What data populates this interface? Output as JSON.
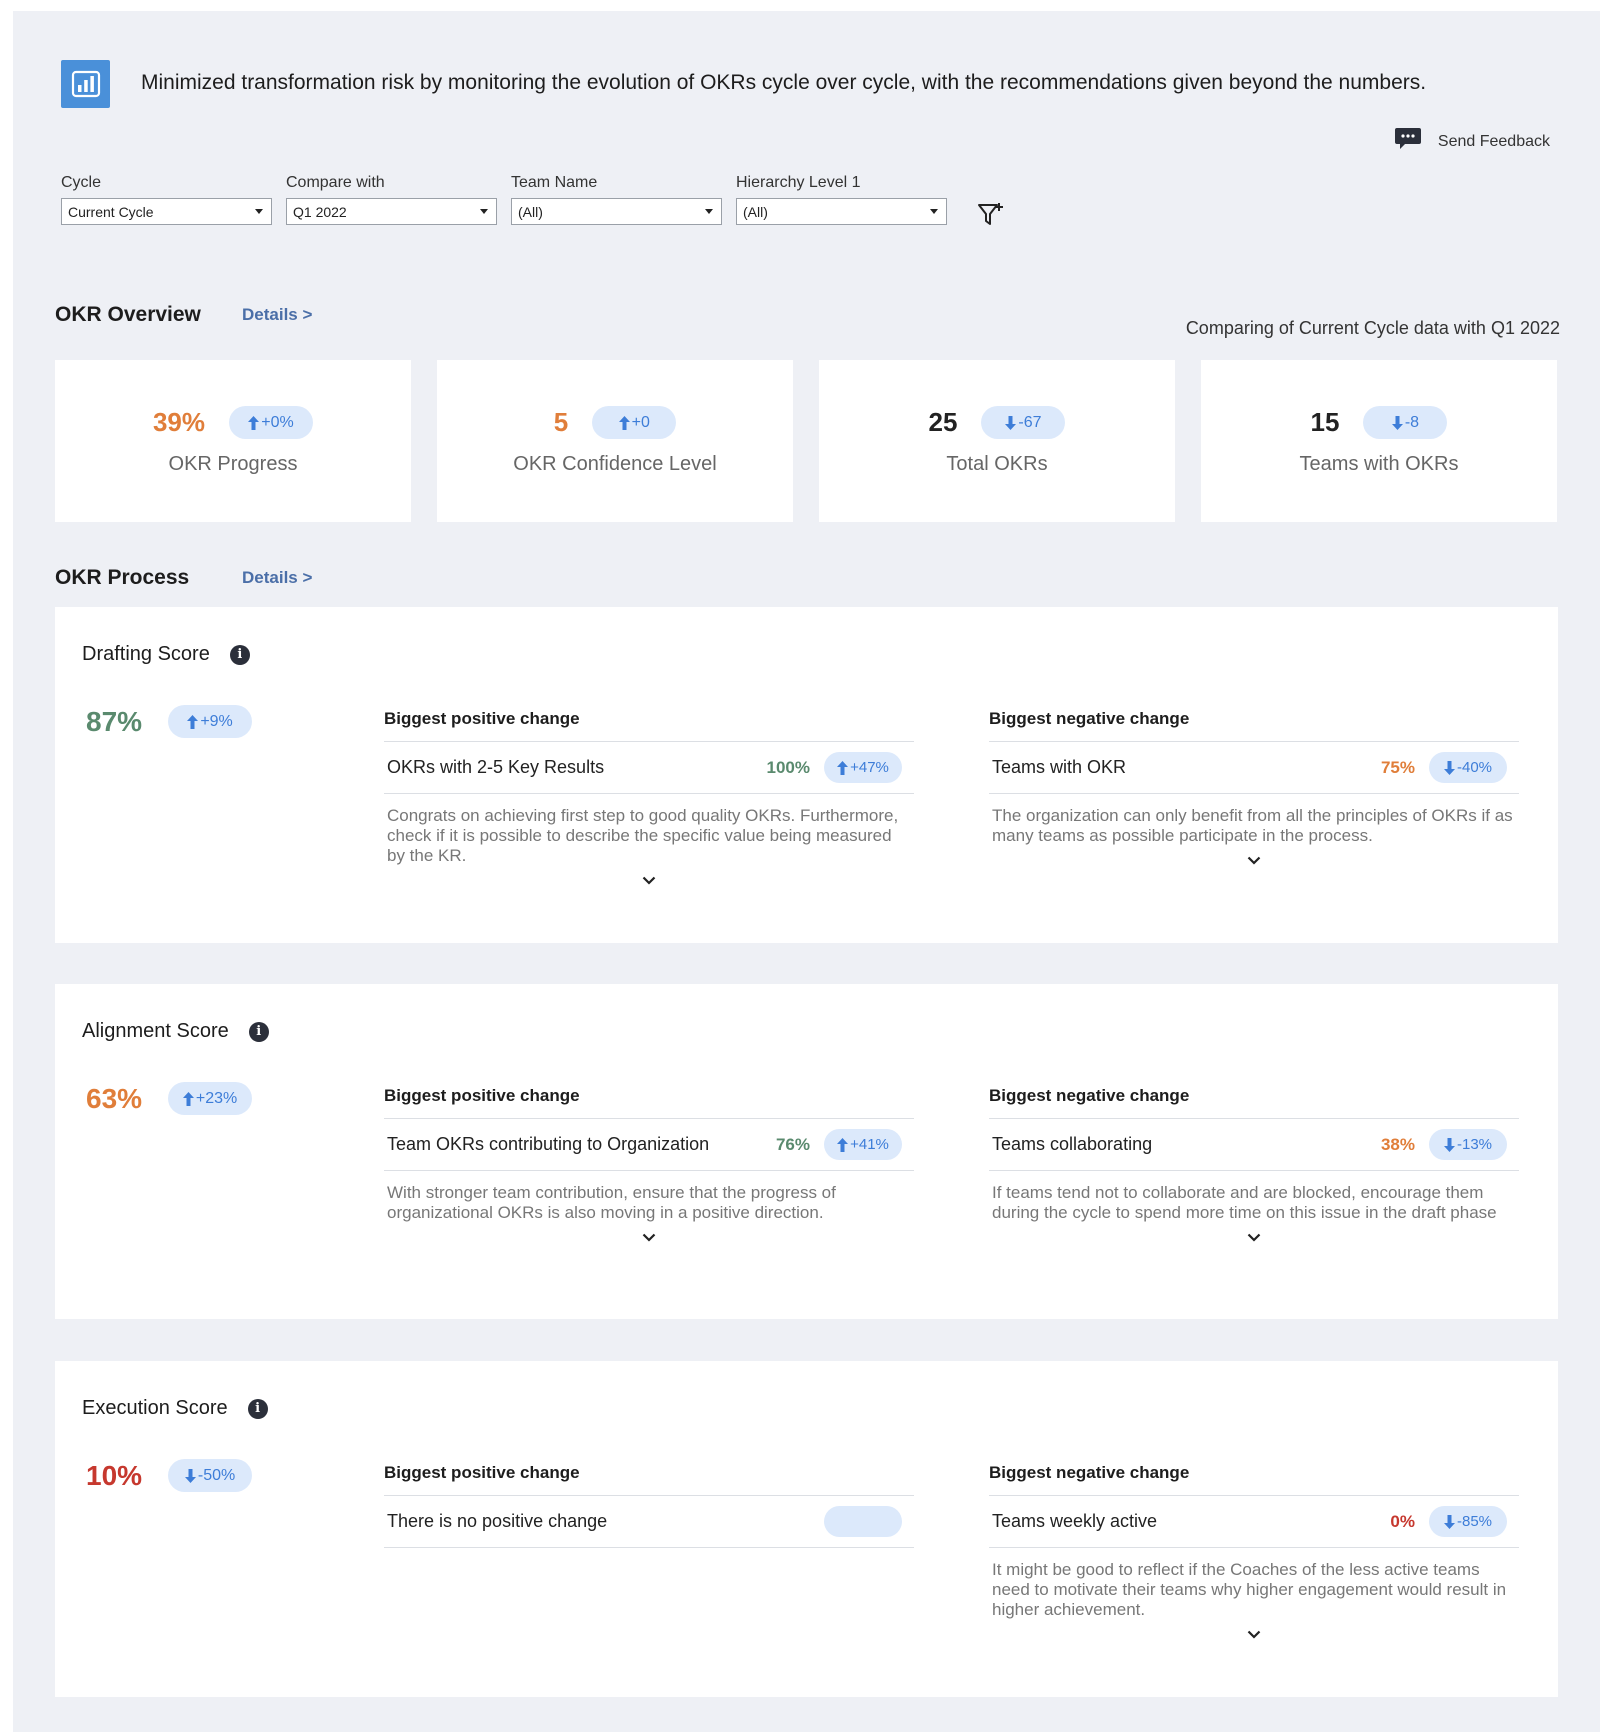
{
  "header": {
    "logo_icon": "bar-chart-icon",
    "headline": "Minimized transformation risk by monitoring the evolution of OKRs cycle over cycle, with the recommendations given beyond the numbers.",
    "feedback_icon": "chat-bubble-icon",
    "feedback_label": "Send Feedback"
  },
  "filters": [
    {
      "label": "Cycle",
      "value": "Current Cycle"
    },
    {
      "label": "Compare with",
      "value": "Q1 2022"
    },
    {
      "label": "Team Name",
      "value": "(All)"
    },
    {
      "label": "Hierarchy Level 1",
      "value": "(All)"
    }
  ],
  "overview": {
    "title": "OKR Overview",
    "details_label": "Details >",
    "compare_note": "Comparing of Current Cycle data with Q1 2022",
    "kpis": [
      {
        "value": "39%",
        "change": "+0%",
        "direction": "up",
        "label": "OKR Progress",
        "color": "#e07e3a"
      },
      {
        "value": "5",
        "change": "+0",
        "direction": "up",
        "label": "OKR Confidence Level",
        "color": "#e07e3a"
      },
      {
        "value": "25",
        "change": "-67",
        "direction": "down",
        "label": "Total OKRs",
        "color": "#222222"
      },
      {
        "value": "15",
        "change": "-8",
        "direction": "down",
        "label": "Teams with OKRs",
        "color": "#222222"
      }
    ]
  },
  "process": {
    "title": "OKR Process",
    "details_label": "Details >",
    "positive_title": "Biggest positive change",
    "negative_title": "Biggest negative change",
    "scores": [
      {
        "title": "Drafting Score",
        "value": "87%",
        "change": "+9%",
        "direction": "up",
        "positive": {
          "label": "OKRs with 2-5 Key Results",
          "pct": "100%",
          "change": "+47%",
          "rec": "Congrats on achieving first step to good quality OKRs. Furthermore, check if it is possible to describe the specific value being measured by the KR."
        },
        "negative": {
          "label": "Teams with OKR",
          "pct": "75%",
          "change": "-40%",
          "rec": "The organization can only benefit from all the principles of OKRs if as many teams as possible participate in the process."
        }
      },
      {
        "title": "Alignment Score",
        "value": "63%",
        "change": "+23%",
        "direction": "up",
        "positive": {
          "label": "Team OKRs contributing to Organization",
          "pct": "76%",
          "change": "+41%",
          "rec": "With stronger team contribution, ensure that the progress of organizational OKRs is also moving in a positive direction."
        },
        "negative": {
          "label": "Teams collaborating",
          "pct": "38%",
          "change": "-13%",
          "rec": "If teams tend not to collaborate and are blocked, encourage them during the cycle to spend more time on this issue in the draft phase"
        }
      },
      {
        "title": "Execution Score",
        "value": "10%",
        "change": "-50%",
        "direction": "down",
        "positive": {
          "label": "There is no positive change"
        },
        "negative": {
          "label": "Teams weekly active",
          "pct": "0%",
          "change": "-85%",
          "rec": "It might be good to reflect if the Coaches of the less active teams need to motivate their teams why higher engagement would result in higher achievement."
        }
      }
    ]
  },
  "colors": {
    "green": "#5a8a6e",
    "orange": "#e07e3a",
    "red": "#c6382e",
    "badge_bg": "#dce9fb",
    "badge_text": "#3d7dd8",
    "link": "#4b6fa8"
  }
}
